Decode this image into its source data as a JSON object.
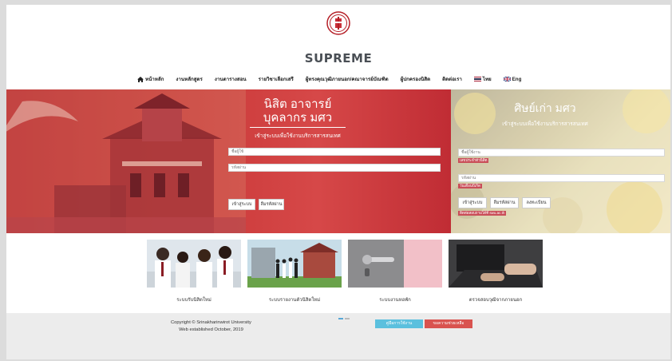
{
  "brand": {
    "name": "SUPREME"
  },
  "nav": {
    "items": [
      {
        "label": "หน้าหลัก"
      },
      {
        "label": "งานหลักสูตร"
      },
      {
        "label": "งานตารางสอน"
      },
      {
        "label": "รายวิชาเลือกเสรี"
      },
      {
        "label": "ผู้ทรงคุณวุฒิภายนอก/คณาจารย์บัณฑิต"
      },
      {
        "label": "ผู้ปกครองนิสิต"
      },
      {
        "label": "ติดต่อเรา"
      },
      {
        "label": "ไทย"
      },
      {
        "label": "Eng"
      }
    ]
  },
  "login_left": {
    "title_line1": "นิสิต อาจารย์",
    "title_line2": "บุคลากร มศว",
    "subtitle": "เข้าสู่ระบบเพื่อใช้งานบริการสารสนเทศ",
    "username_placeholder": "ชื่อผู้ใช้",
    "password_placeholder": "รหัสผ่าน",
    "login_label": "เข้าสู่ระบบ",
    "forgot_label": "ลืมรหัสผ่าน"
  },
  "login_right": {
    "title": "ศิษย์เก่า มศว",
    "subtitle": "เข้าสู่ระบบเพื่อใช้งานบริการสารสนเทศ",
    "username_placeholder": "ชื่อผู้ใช้งาน",
    "username_hint": "เลขประจำตัวนิสิต",
    "password_placeholder": "รหัสผ่าน",
    "password_hint": "วันเดือนปีเกิด",
    "login_label": "เข้าสู่ระบบ",
    "forgot_label": "ลืมรหัสผ่าน",
    "register_label": "ลงทะเบียน",
    "note": "ติดต่อสอบถามได้ที่ swu.ac.th"
  },
  "cards": [
    {
      "caption": "ระบบรับนิสิตใหม่"
    },
    {
      "caption": "ระบบรายงานตัวนิสิตใหม่"
    },
    {
      "caption": "ระบบงานหอพัก"
    },
    {
      "caption": "ตรวจสอบวุฒิจากภายนอก"
    }
  ],
  "footer": {
    "copyright": "Copyright © Srinakharinwirot University",
    "established": "Web established October, 2019",
    "manual_label": "คู่มือการใช้งาน",
    "help_label": "ขอความช่วยเหลือ"
  },
  "colors": {
    "primary": "#c93838",
    "manual": "#5bc0de",
    "help": "#d9534f"
  }
}
